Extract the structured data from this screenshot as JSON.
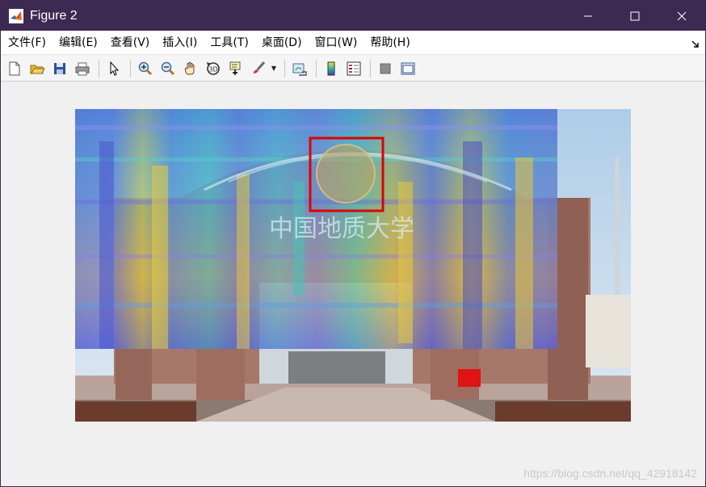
{
  "window": {
    "title": "Figure 2"
  },
  "menu": {
    "items": [
      "文件(F)",
      "编辑(E)",
      "查看(V)",
      "插入(I)",
      "工具(T)",
      "桌面(D)",
      "窗口(W)",
      "帮助(H)"
    ]
  },
  "toolbar": {
    "icons": [
      "new-figure-icon",
      "open-file-icon",
      "save-icon",
      "print-icon",
      "select-arrow-icon",
      "zoom-in-icon",
      "zoom-out-icon",
      "pan-hand-icon",
      "rotate-3d-icon",
      "data-cursor-icon",
      "brush-icon",
      "link-plot-icon",
      "colorbar-icon",
      "legend-icon",
      "hide-plot-tools-icon",
      "show-plot-tools-icon"
    ]
  },
  "figure": {
    "image_description_label": "campus gate with heatmap overlay",
    "overlay_sign_text": "中国地质大学",
    "highlight_box_color": "#e00000"
  },
  "watermark": {
    "text": "https://blog.csdn.net/qq_42918142"
  },
  "colors": {
    "titlebar": "#3c2a52",
    "menubar": "#ffffff",
    "toolbar": "#f5f5f5",
    "canvas": "#f0f0f0"
  }
}
